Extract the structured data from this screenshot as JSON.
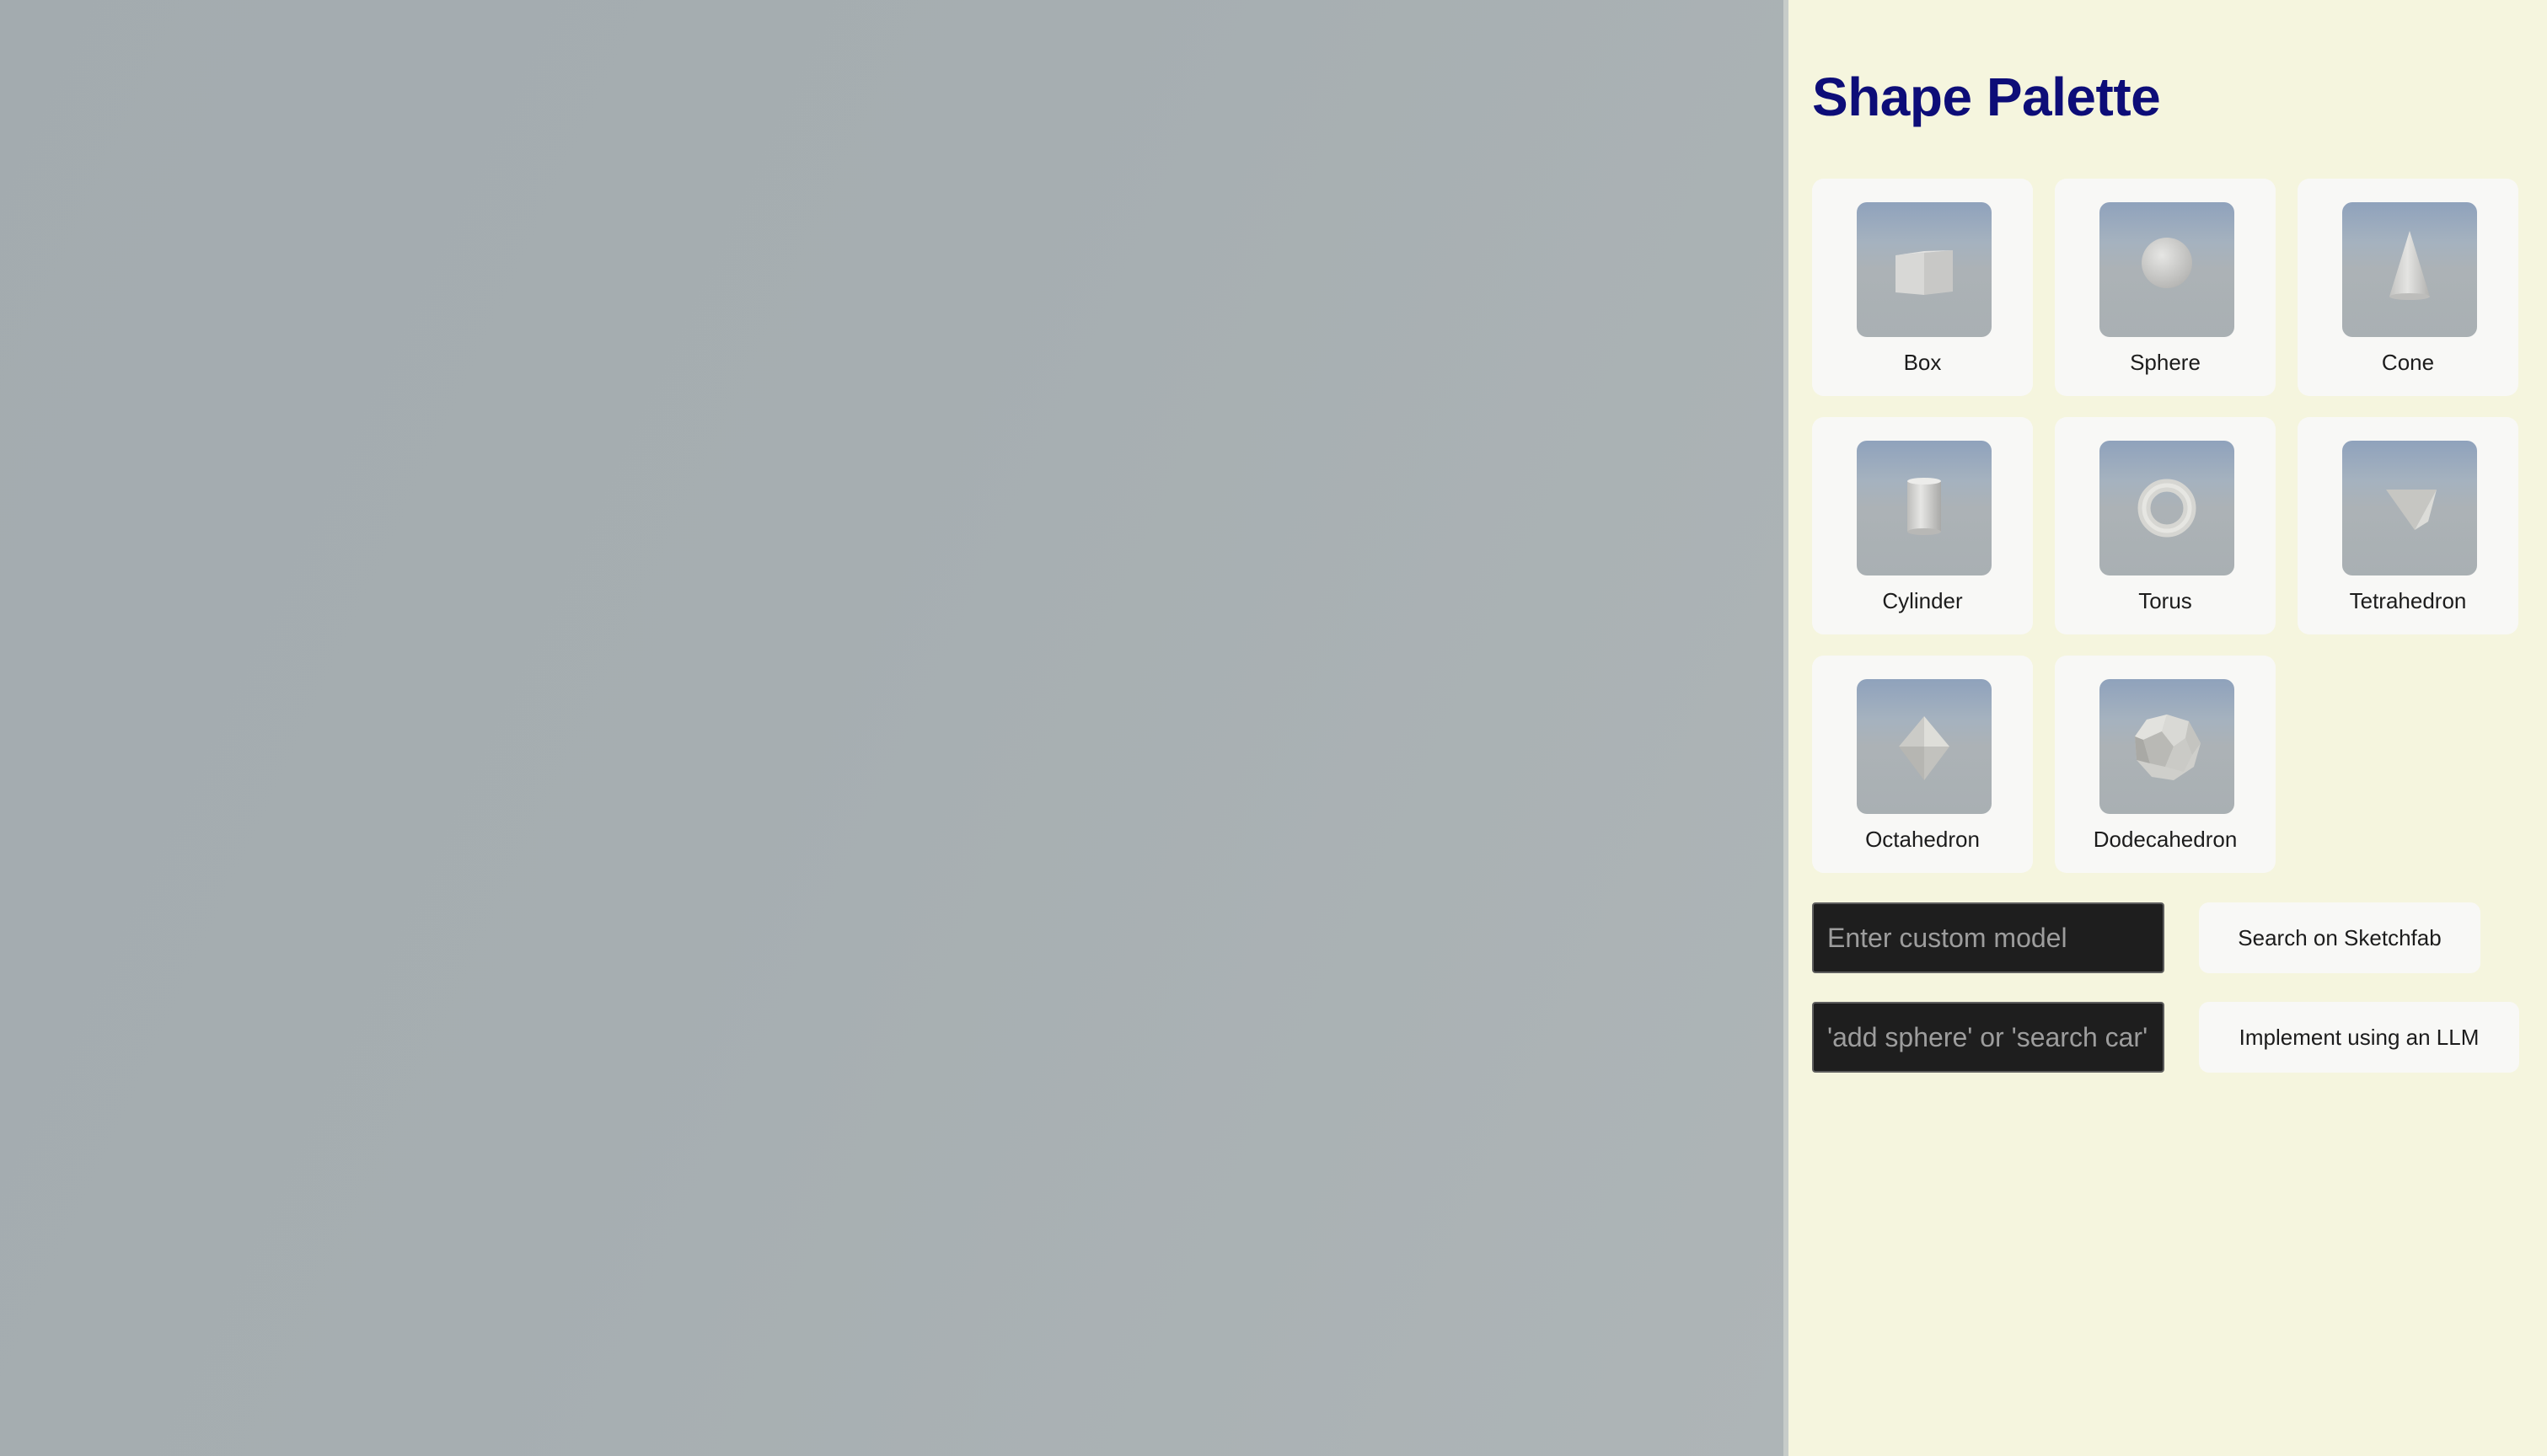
{
  "palette": {
    "title": "Shape Palette",
    "shapes": [
      {
        "label": "Box",
        "icon": "box-icon"
      },
      {
        "label": "Sphere",
        "icon": "sphere-icon"
      },
      {
        "label": "Cone",
        "icon": "cone-icon"
      },
      {
        "label": "Cylinder",
        "icon": "cylinder-icon"
      },
      {
        "label": "Torus",
        "icon": "torus-icon"
      },
      {
        "label": "Tetrahedron",
        "icon": "tetrahedron-icon"
      },
      {
        "label": "Octahedron",
        "icon": "octahedron-icon"
      },
      {
        "label": "Dodecahedron",
        "icon": "dodecahedron-icon"
      }
    ]
  },
  "custom_model": {
    "placeholder": "Enter custom model",
    "value": "",
    "button_label": "Search on Sketchfab"
  },
  "command": {
    "placeholder": "'add sphere' or 'search car'",
    "value": "",
    "button_label": "Implement using an LLM"
  },
  "colors": {
    "title": "#0d0d78",
    "panel_background": "#f5f5de",
    "card_background": "#f8f8f6",
    "input_background": "#1e1e1e",
    "viewport_background": "#a6aeb1"
  }
}
